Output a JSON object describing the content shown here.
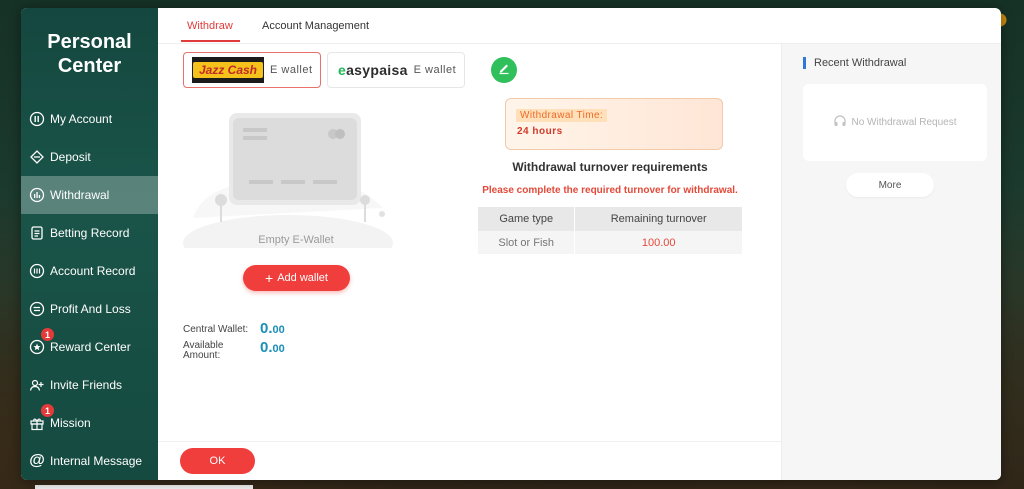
{
  "sidebar": {
    "title_line1": "Personal",
    "title_line2": "Center",
    "items": [
      {
        "label": "My Account",
        "icon": "account-icon"
      },
      {
        "label": "Deposit",
        "icon": "deposit-icon"
      },
      {
        "label": "Withdrawal",
        "icon": "withdrawal-icon"
      },
      {
        "label": "Betting Record",
        "icon": "betting-record-icon"
      },
      {
        "label": "Account Record",
        "icon": "account-record-icon"
      },
      {
        "label": "Profit And Loss",
        "icon": "profit-loss-icon"
      },
      {
        "label": "Reward Center",
        "icon": "reward-icon",
        "badge": "1"
      },
      {
        "label": "Invite Friends",
        "icon": "invite-icon"
      },
      {
        "label": "Mission",
        "icon": "gift-icon",
        "badge": "1"
      },
      {
        "label": "Internal Message",
        "icon": "at-icon"
      }
    ],
    "active_index": 2
  },
  "tabs": [
    {
      "label": "Withdraw",
      "active": true
    },
    {
      "label": "Account Management",
      "active": false
    }
  ],
  "wallets": [
    {
      "brand": "Jazz Cash",
      "suffix": "E wallet",
      "selected": true
    },
    {
      "brand": "easypaisa",
      "suffix": "E wallet",
      "selected": false
    }
  ],
  "empty_wallet_label": "Empty E-Wallet",
  "add_wallet_label": "Add wallet",
  "central_wallet": {
    "label": "Central Wallet:",
    "int": "0.",
    "dec": "00"
  },
  "available_amount": {
    "label_line1": "Available",
    "label_line2": "Amount:",
    "int": "0.",
    "dec": "00"
  },
  "ok_label": "OK",
  "withdrawal_time": {
    "label": "Withdrawal Time:",
    "value": "24 hours"
  },
  "turnover": {
    "title": "Withdrawal turnover requirements",
    "warning": "Please complete the required turnover for withdrawal.",
    "headers": [
      "Game type",
      "Remaining turnover"
    ],
    "rows": [
      [
        "Slot or Fish",
        "100.00"
      ]
    ]
  },
  "recent": {
    "title": "Recent Withdrawal",
    "empty_text": "No Withdrawal Request",
    "more_label": "More"
  },
  "colors": {
    "accent": "#ef3e3b",
    "sidebar": "#1a5449",
    "amount": "#1a8fb7",
    "edit": "#2fbf5b"
  }
}
